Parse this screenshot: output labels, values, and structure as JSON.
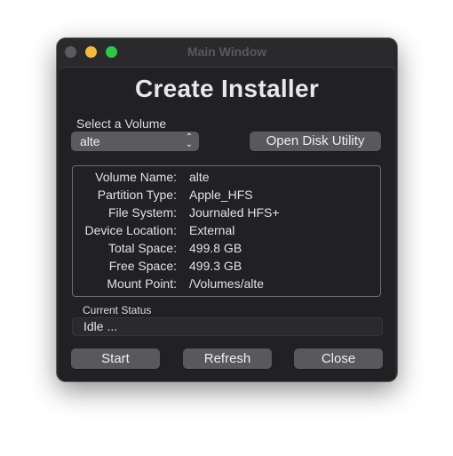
{
  "window": {
    "title": "Main Window",
    "traffic_lights": {
      "close": "#5b5a5d",
      "minimize": "#f5b93e",
      "maximize": "#2dc845"
    }
  },
  "heading": "Create Installer",
  "volume_select": {
    "label": "Select a Volume",
    "selected": "alte",
    "icon": "up-down-chevron-icon"
  },
  "open_disk_utility_label": "Open Disk Utility",
  "volume_info": [
    {
      "key": "Volume Name:",
      "value": "alte"
    },
    {
      "key": "Partition Type:",
      "value": "Apple_HFS"
    },
    {
      "key": "File System:",
      "value": "Journaled HFS+"
    },
    {
      "key": "Device Location:",
      "value": "External"
    },
    {
      "key": "Total Space:",
      "value": "499.8 GB"
    },
    {
      "key": "Free Space:",
      "value": "499.3 GB"
    },
    {
      "key": "Mount Point:",
      "value": "/Volumes/alte"
    }
  ],
  "status": {
    "label": "Current Status",
    "value": "Idle ..."
  },
  "buttons": {
    "start": "Start",
    "refresh": "Refresh",
    "close": "Close"
  }
}
